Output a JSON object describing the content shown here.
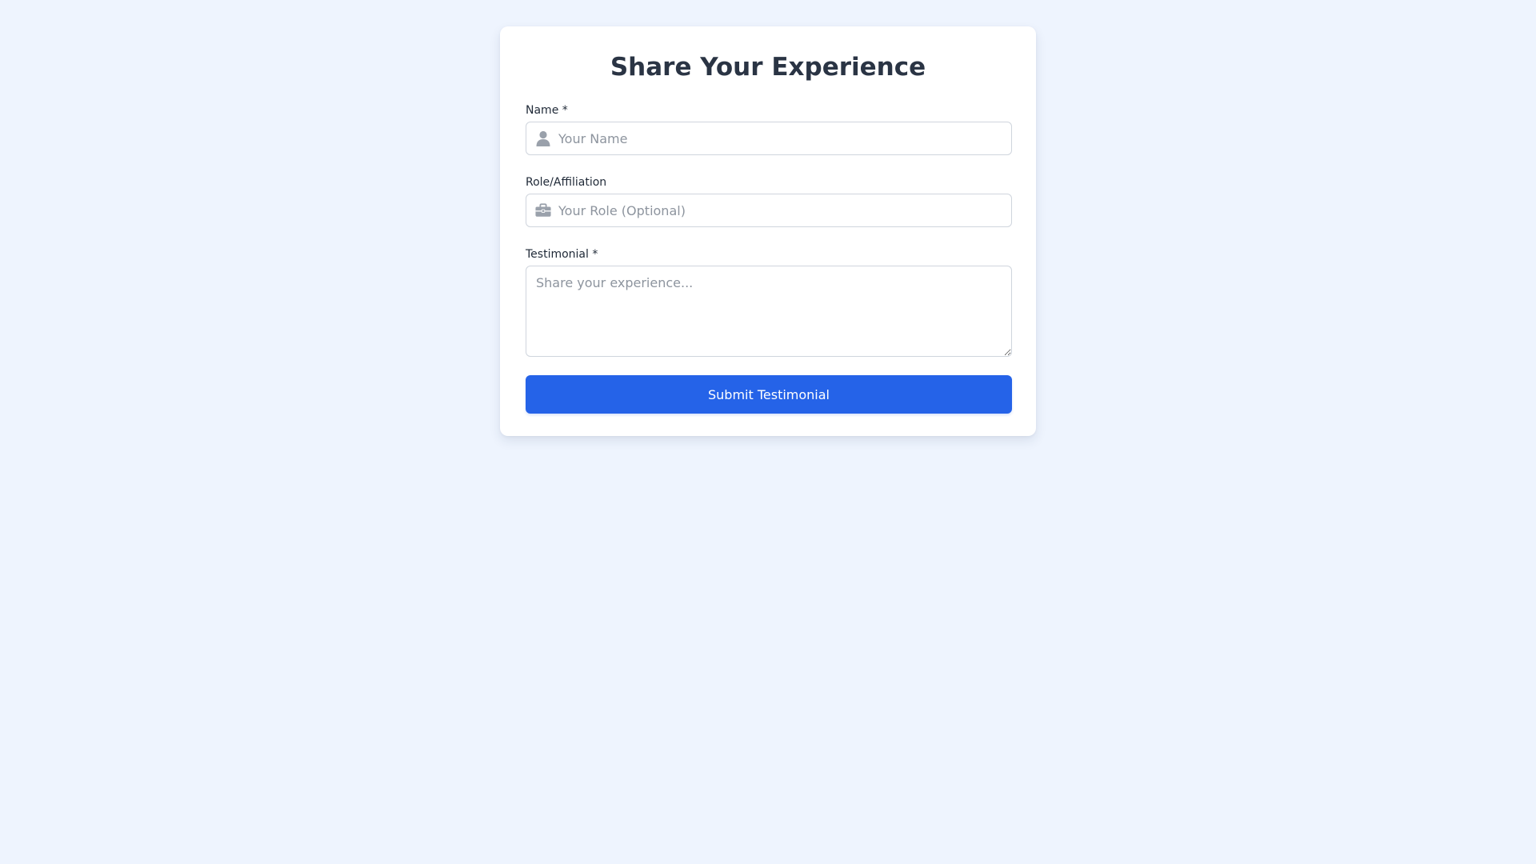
{
  "form": {
    "title": "Share Your Experience",
    "name": {
      "label": "Name *",
      "placeholder": "Your Name",
      "value": "",
      "icon": "user-icon"
    },
    "role": {
      "label": "Role/Affiliation",
      "placeholder": "Your Role (Optional)",
      "value": "",
      "icon": "briefcase-icon"
    },
    "testimonial": {
      "label": "Testimonial *",
      "placeholder": "Share your experience...",
      "value": ""
    },
    "submit_label": "Submit Testimonial"
  },
  "colors": {
    "background": "#eef4fe",
    "accent": "#2563e8",
    "title": "#2a3444",
    "icon": "#9aa1ab"
  }
}
